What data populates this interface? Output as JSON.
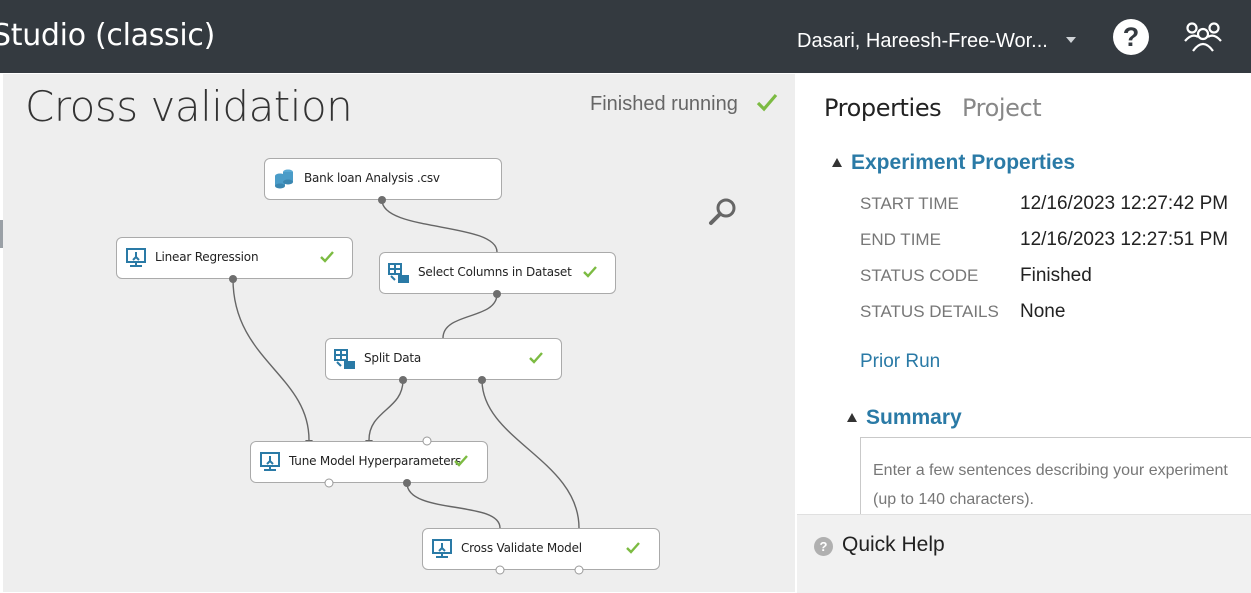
{
  "header": {
    "app_title": "Studio (classic)",
    "user_name": "Dasari, Hareesh-Free-Wor...",
    "help_glyph": "?"
  },
  "experiment": {
    "title": "Cross validation",
    "status": "Finished running"
  },
  "modules": [
    {
      "label": "Bank loan Analysis .csv",
      "icon": "dataset-icon",
      "completed": false
    },
    {
      "label": "Linear Regression",
      "icon": "model-icon",
      "completed": true
    },
    {
      "label": "Select Columns in Dataset",
      "icon": "table-transform-icon",
      "completed": true
    },
    {
      "label": "Split Data",
      "icon": "table-transform-icon",
      "completed": true
    },
    {
      "label": "Tune Model Hyperparameters",
      "icon": "model-icon",
      "completed": true
    },
    {
      "label": "Cross Validate Model",
      "icon": "model-icon",
      "completed": true
    }
  ],
  "panel": {
    "tabs": [
      "Properties",
      "Project"
    ],
    "experiment_properties_heading": "Experiment Properties",
    "properties": [
      {
        "key": "START TIME",
        "value": "12/16/2023 12:27:42 PM"
      },
      {
        "key": "END TIME",
        "value": "12/16/2023 12:27:51 PM"
      },
      {
        "key": "STATUS CODE",
        "value": "Finished"
      },
      {
        "key": "STATUS DETAILS",
        "value": "None"
      }
    ],
    "prior_run": "Prior Run",
    "summary_heading": "Summary",
    "summary_placeholder": "Enter a few sentences describing your experiment (up to 140 characters)."
  },
  "quick_help": {
    "label": "Quick Help",
    "glyph": "?"
  },
  "colors": {
    "topbar": "#343a40",
    "accent": "#2a7aa6",
    "check": "#7cbb42",
    "canvas": "#eeeeee"
  }
}
